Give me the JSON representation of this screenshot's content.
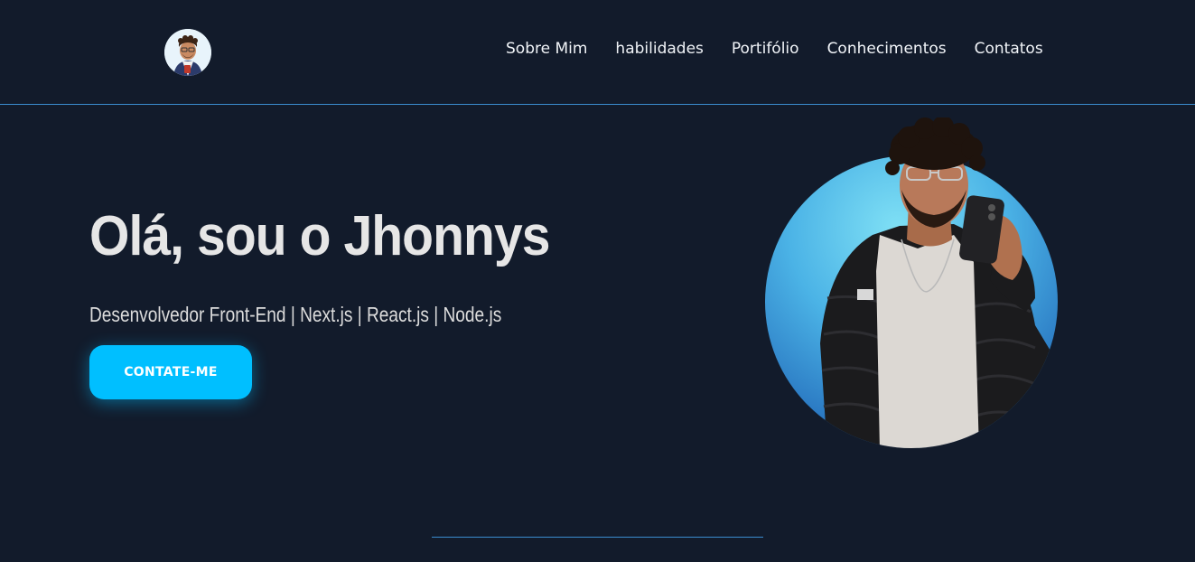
{
  "header": {
    "logo_icon": "avatar-icon",
    "nav": [
      {
        "label": "Sobre Mim"
      },
      {
        "label": "habilidades"
      },
      {
        "label": "Portifólio"
      },
      {
        "label": "Conhecimentos"
      },
      {
        "label": "Contatos"
      }
    ]
  },
  "hero": {
    "title": "Olá, sou o Jhonnys",
    "subtitle": "Desenvolvedor Front-End | Next.js | React.js | Node.js",
    "cta_label": "CONTATE-ME"
  },
  "colors": {
    "background": "#121b2b",
    "accent": "#00bfff",
    "divider": "#3a8ccf"
  }
}
